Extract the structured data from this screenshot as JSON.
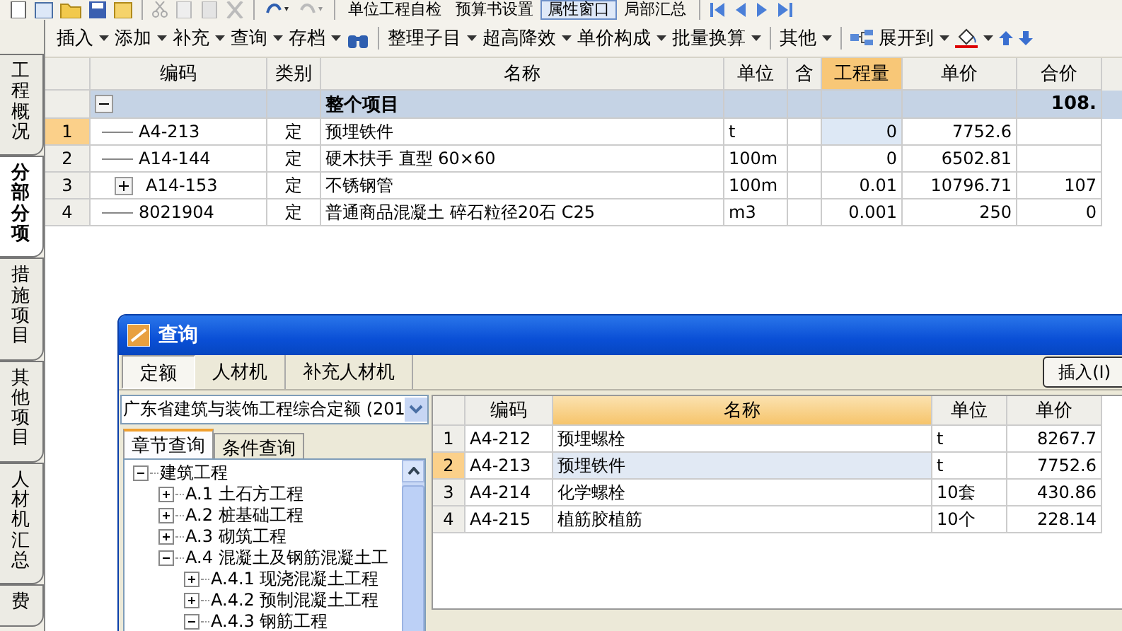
{
  "toolbar_top": {
    "buttons": [
      {
        "label": "单位工程自检",
        "pressed": false
      },
      {
        "label": "预算书设置",
        "pressed": false
      },
      {
        "label": "属性窗口",
        "pressed": true
      },
      {
        "label": "局部汇总",
        "pressed": false
      }
    ]
  },
  "toolbar": {
    "items": [
      {
        "label": "插入"
      },
      {
        "label": "添加"
      },
      {
        "label": "补充"
      },
      {
        "label": "查询"
      },
      {
        "label": "存档"
      }
    ],
    "items2": [
      {
        "label": "整理子目"
      },
      {
        "label": "超高降效"
      },
      {
        "label": "单价构成"
      },
      {
        "label": "批量换算"
      }
    ],
    "items3": [
      {
        "label": "其他"
      }
    ],
    "expand": {
      "label": "展开到"
    }
  },
  "side_tabs": [
    {
      "label": "工程概况",
      "selected": false
    },
    {
      "label": "分部分项",
      "selected": true
    },
    {
      "label": "措施项目",
      "selected": false
    },
    {
      "label": "其他项目",
      "selected": false
    },
    {
      "label": "人材机汇总",
      "selected": false
    },
    {
      "label": "费",
      "selected": false
    }
  ],
  "table": {
    "columns": [
      "编码",
      "类别",
      "名称",
      "单位",
      "含",
      "工程量",
      "单价",
      "合价"
    ],
    "group": {
      "name": "整个项目",
      "total": "108.",
      "expanded": true
    },
    "rows": [
      {
        "index": "1",
        "code": "A4-213",
        "type": "定",
        "name": "预埋铁件",
        "unit": "t",
        "qty": "0",
        "price": "7752.6",
        "total": "",
        "selected": true,
        "has_children": false
      },
      {
        "index": "2",
        "code": "A14-144",
        "type": "定",
        "name": "硬木扶手 直型 60×60",
        "unit": "100m",
        "qty": "0",
        "price": "6502.81",
        "total": "",
        "selected": false,
        "has_children": false
      },
      {
        "index": "3",
        "code": "A14-153",
        "type": "定",
        "name": "不锈钢管",
        "unit": "100m",
        "qty": "0.01",
        "price": "10796.71",
        "total": "107",
        "selected": false,
        "has_children": true
      },
      {
        "index": "4",
        "code": "8021904",
        "type": "定",
        "name": "普通商品混凝土 碎石粒径20石 C25",
        "unit": "m3",
        "qty": "0.001",
        "price": "250",
        "total": "0",
        "selected": false,
        "has_children": false
      }
    ]
  },
  "dialog": {
    "title": "查询",
    "tabs": [
      {
        "label": "定额",
        "selected": true
      },
      {
        "label": "人材机",
        "selected": false
      },
      {
        "label": "补充人材机",
        "selected": false
      }
    ],
    "library": "广东省建筑与装饰工程综合定额 (201",
    "subtabs": [
      {
        "label": "章节查询",
        "selected": true
      },
      {
        "label": "条件查询",
        "selected": false
      }
    ],
    "tree": [
      {
        "label": "建筑工程",
        "expanded": true,
        "children": [
          {
            "label": "A.1  土石方工程",
            "expanded": false
          },
          {
            "label": "A.2  桩基础工程",
            "expanded": false
          },
          {
            "label": "A.3  砌筑工程",
            "expanded": false
          },
          {
            "label": "A.4  混凝土及钢筋混凝土工",
            "expanded": true,
            "children": [
              {
                "label": "A.4.1  现浇混凝土工程",
                "expanded": false
              },
              {
                "label": "A.4.2  预制混凝土工程",
                "expanded": false
              },
              {
                "label": "A.4.3  钢筋工程",
                "expanded": true
              }
            ]
          }
        ]
      }
    ],
    "insert_button": "插入(I)",
    "columns": [
      "编码",
      "名称",
      "单位",
      "单价"
    ],
    "rows": [
      {
        "index": "1",
        "code": "A4-212",
        "name": "预埋螺栓",
        "unit": "t",
        "price": "8267.7",
        "selected": false
      },
      {
        "index": "2",
        "code": "A4-213",
        "name": "预埋铁件",
        "unit": "t",
        "price": "7752.6",
        "selected": true
      },
      {
        "index": "3",
        "code": "A4-214",
        "name": "化学螺栓",
        "unit": "10套",
        "price": "430.86",
        "selected": false
      },
      {
        "index": "4",
        "code": "A4-215",
        "name": "植筋胶植筋",
        "unit": "10个",
        "price": "228.14",
        "selected": false
      }
    ]
  }
}
